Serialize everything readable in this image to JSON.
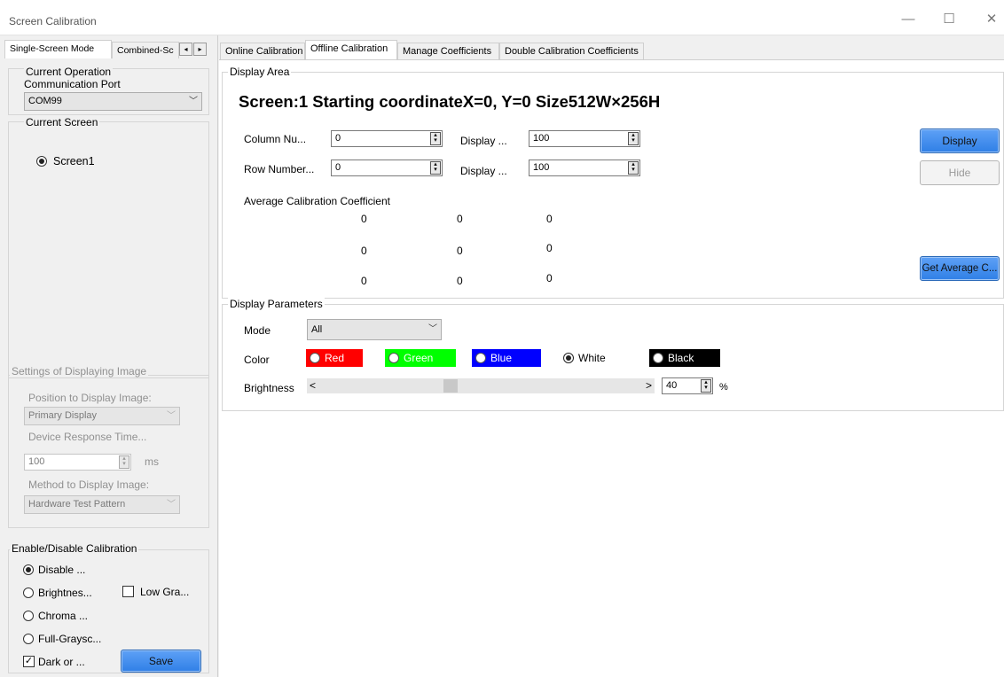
{
  "window": {
    "title": "Screen Calibration",
    "minimize_glyph": "—",
    "maximize_glyph": "☐",
    "close_glyph": "✕"
  },
  "left_tabs": [
    "Single-Screen Mode",
    "Combined-Sc"
  ],
  "tab_scroll": {
    "left": "◂",
    "right": "▸"
  },
  "current_operation": {
    "group_label": "Current Operation",
    "port_label": "Communication Port",
    "port_value": "COM99"
  },
  "current_screen": {
    "group_label": "Current Screen",
    "screen": "Screen1"
  },
  "display_image_settings": {
    "group_label": "Settings of Displaying Image",
    "position_label": "Position to Display Image:",
    "position_value": "Primary Display",
    "response_label": "Device Response Time...",
    "response_value": "100",
    "response_unit": "ms",
    "method_label": "Method to Display Image:",
    "method_value": "Hardware Test Pattern"
  },
  "calibration": {
    "group_label": "Enable/Disable Calibration",
    "disable": "Disable ...",
    "brightness": "Brightnes...",
    "low_gray": "Low Gra...",
    "chroma": "Chroma ...",
    "full_grayscale": "Full-Graysc...",
    "dark_or": "Dark or ...",
    "save": "Save"
  },
  "main_tabs": [
    "Online Calibration",
    "Offline Calibration",
    "Manage Coefficients",
    "Double Calibration Coefficients"
  ],
  "display_area": {
    "group_label": "Display Area",
    "headline": "Screen:1  Starting coordinateX=0, Y=0  Size512W×256H",
    "column_label": "Column Nu...",
    "column_value": "0",
    "row_label": "Row Number...",
    "row_value": "0",
    "display1_label": "Display ...",
    "display1_value": "100",
    "display2_label": "Display ...",
    "display2_value": "100",
    "display_button": "Display",
    "hide_button": "Hide",
    "avg_label": "Average Calibration Coefficient",
    "avg_rows": [
      [
        "0",
        "0",
        "0"
      ],
      [
        "0",
        "0",
        "0"
      ],
      [
        "0",
        "0",
        "0"
      ]
    ],
    "get_avg_button": "Get Average C..."
  },
  "display_params": {
    "group_label": "Display Parameters",
    "mode_label": "Mode",
    "mode_value": "All",
    "color_label": "Color",
    "colors": {
      "red": "Red",
      "green": "Green",
      "blue": "Blue",
      "white": "White",
      "black": "Black"
    },
    "color_hex": {
      "red": "#ff0000",
      "green": "#00ff00",
      "blue": "#0000ff",
      "white": "#ffffff",
      "black": "#000000"
    },
    "brightness_label": "Brightness",
    "brightness_value": "40",
    "brightness_unit": "%",
    "slider_left": "<",
    "slider_right": ">"
  }
}
